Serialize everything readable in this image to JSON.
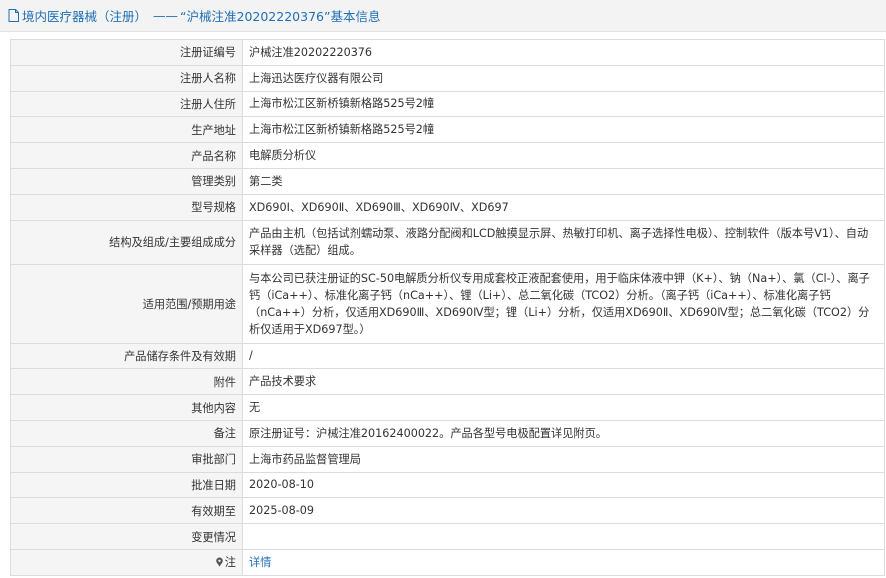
{
  "header": {
    "prefix": "境内医疗器械（注册）",
    "separator": "——",
    "record": "“沪械注准20202220376”",
    "suffix": "基本信息"
  },
  "rows": [
    {
      "label": "注册证编号",
      "value": "沪械注准20202220376"
    },
    {
      "label": "注册人名称",
      "value": "上海迅达医疗仪器有限公司"
    },
    {
      "label": "注册人住所",
      "value": "上海市松江区新桥镇新格路525号2幢"
    },
    {
      "label": "生产地址",
      "value": "上海市松江区新桥镇新格路525号2幢"
    },
    {
      "label": "产品名称",
      "value": "电解质分析仪"
    },
    {
      "label": "管理类别",
      "value": "第二类"
    },
    {
      "label": "型号规格",
      "value": "XD690Ⅰ、XD690Ⅱ、XD690Ⅲ、XD690Ⅳ、XD697"
    },
    {
      "label": "结构及组成/主要组成成分",
      "value": "产品由主机（包括试剂蠕动泵、液路分配阀和LCD触摸显示屏、热敏打印机、离子选择性电极）、控制软件（版本号V1）、自动采样器（选配）组成。"
    },
    {
      "label": "适用范围/预期用途",
      "value": "与本公司已获注册证的SC-50电解质分析仪专用成套校正液配套使用，用于临床体液中钾（K+）、钠（Na+）、氯（Cl-）、离子钙（iCa++）、标准化离子钙（nCa++）、锂（Li+）、总二氧化碳（TCO2）分析。（离子钙（iCa++）、标准化离子钙（nCa++）分析，仅适用XD690Ⅲ、XD690Ⅳ型；锂（Li+）分析，仅适用XD690Ⅱ、XD690Ⅳ型；总二氧化碳（TCO2）分析仅适用于XD697型。）"
    },
    {
      "label": "产品储存条件及有效期",
      "value": "/"
    },
    {
      "label": "附件",
      "value": "产品技术要求"
    },
    {
      "label": "其他内容",
      "value": "无"
    },
    {
      "label": "备注",
      "value": "原注册证号：沪械注准20162400022。产品各型号电极配置详见附页。"
    },
    {
      "label": "审批部门",
      "value": "上海市药品监督管理局"
    },
    {
      "label": "批准日期",
      "value": "2020-08-10"
    },
    {
      "label": "有效期至",
      "value": "2025-08-09"
    },
    {
      "label": "变更情况",
      "value": ""
    },
    {
      "label": "注",
      "value": "详情"
    }
  ],
  "icons": {
    "header": "document-icon",
    "note": "pin-icon"
  },
  "colors": {
    "link": "#1f6fb7",
    "label_bg": "#f5f5f5",
    "border": "#dcdcdc"
  }
}
